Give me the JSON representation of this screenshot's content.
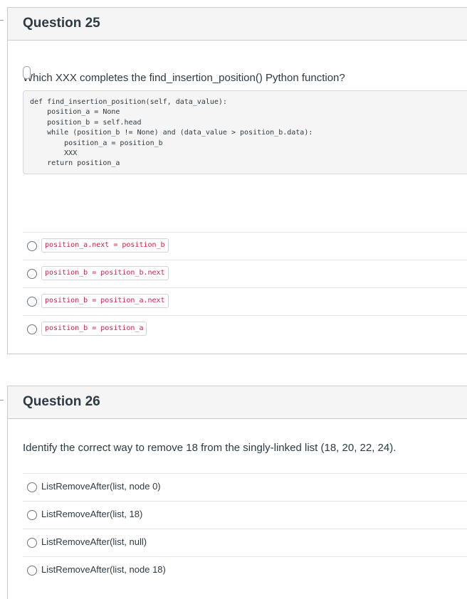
{
  "questions": [
    {
      "title": "Question 25",
      "prompt": "Which XXX completes the find_insertion_position() Python function?",
      "code": "def find_insertion_position(self, data_value):\n    position_a = None\n    position_b = self.head\n    while (position_b != None) and (data_value > position_b.data):\n        position_a = position_b\n        XXX\n    return position_a",
      "options": [
        "position_a.next = position_b",
        "position_b = position_b.next",
        "position_b = position_a.next",
        "position_b = position_a"
      ]
    },
    {
      "title": "Question 26",
      "prompt": "Identify the correct way to remove 18 from the singly-linked list (18, 20, 22, 24).",
      "options": [
        "ListRemoveAfter(list, node 0)",
        "ListRemoveAfter(list, 18)",
        "ListRemoveAfter(list, null)",
        "ListRemoveAfter(list, node 18)"
      ]
    }
  ]
}
